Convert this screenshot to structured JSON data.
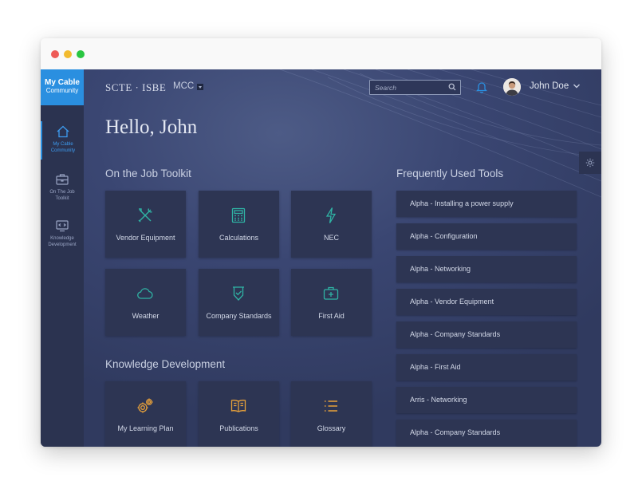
{
  "window": {
    "controls": [
      "close",
      "minimize",
      "maximize"
    ]
  },
  "brand": {
    "line1": "My Cable",
    "line2": "Community",
    "color": "#2a8fe0"
  },
  "sidebar": {
    "items": [
      {
        "label_line1": "My Cable",
        "label_line2": "Community",
        "icon": "home-icon",
        "active": true
      },
      {
        "label_line1": "On The Job",
        "label_line2": "Toolkit",
        "icon": "toolbox-icon",
        "active": false
      },
      {
        "label_line1": "Knowledge",
        "label_line2": "Development",
        "icon": "code-screen-icon",
        "active": false
      }
    ]
  },
  "header": {
    "logo": "SCTE · ISBE",
    "selector": "MCC",
    "search_placeholder": "Search",
    "user_name": "John Doe"
  },
  "greeting": "Hello, John",
  "toolkit": {
    "title": "On the Job Toolkit",
    "tiles": [
      {
        "label": "Vendor Equipment",
        "icon": "tools-icon"
      },
      {
        "label": "Calculations",
        "icon": "calculator-icon"
      },
      {
        "label": "NEC",
        "icon": "lightning-icon"
      },
      {
        "label": "Weather",
        "icon": "cloud-icon"
      },
      {
        "label": "Company Standards",
        "icon": "badge-check-icon"
      },
      {
        "label": "First Aid",
        "icon": "first-aid-kit-icon"
      }
    ]
  },
  "knowledge": {
    "title": "Knowledge Development",
    "tiles": [
      {
        "label": "My Learning Plan",
        "icon": "gears-icon"
      },
      {
        "label": "Publications",
        "icon": "open-book-icon"
      },
      {
        "label": "Glossary",
        "icon": "list-icon"
      }
    ]
  },
  "frequent": {
    "title": "Frequently Used Tools",
    "items": [
      "Alpha - Installing a power supply",
      "Alpha - Configuration",
      "Alpha - Networking",
      "Alpha - Vendor Equipment",
      "Alpha - Company Standards",
      "Alpha - First Aid",
      "Arris - Networking",
      "Alpha - Company Standards"
    ]
  },
  "colors": {
    "teal_icon": "#2fb3a4",
    "orange_icon": "#e8a13a",
    "notification": "#2a8fe0"
  }
}
